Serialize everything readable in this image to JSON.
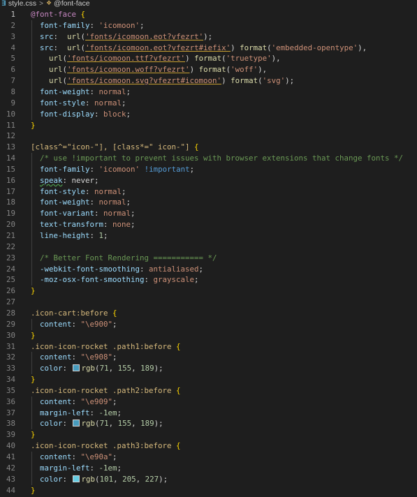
{
  "breadcrumb": {
    "file_icon": "css-file-icon",
    "file_name": "style.css",
    "separator": ">",
    "symbol_icon": "symbol-icon",
    "symbol_name": "@font-face"
  },
  "active_line": "1",
  "lines": [
    {
      "n": "1",
      "indent": 0,
      "tokens": [
        [
          "kw",
          "@font-face"
        ],
        [
          "punc",
          " "
        ],
        [
          "brace",
          "{"
        ]
      ]
    },
    {
      "n": "2",
      "indent": 1,
      "tokens": [
        [
          "prop",
          "font-family"
        ],
        [
          "punc",
          ": "
        ],
        [
          "str",
          "'icomoon'"
        ],
        [
          "punc",
          ";"
        ]
      ]
    },
    {
      "n": "3",
      "indent": 1,
      "tokens": [
        [
          "prop",
          "src"
        ],
        [
          "punc",
          ":  "
        ],
        [
          "fn",
          "url"
        ],
        [
          "punc",
          "("
        ],
        [
          "url ul",
          "'fonts/icomoon.eot?vfezrt'"
        ],
        [
          "punc",
          ");"
        ]
      ]
    },
    {
      "n": "4",
      "indent": 1,
      "tokens": [
        [
          "prop",
          "src"
        ],
        [
          "punc",
          ":  "
        ],
        [
          "fn",
          "url"
        ],
        [
          "punc",
          "("
        ],
        [
          "url ul",
          "'fonts/icomoon.eot?vfezrt#iefix'"
        ],
        [
          "punc",
          ") "
        ],
        [
          "fn",
          "format"
        ],
        [
          "punc",
          "("
        ],
        [
          "str",
          "'embedded-opentype'"
        ],
        [
          "punc",
          "),"
        ]
      ]
    },
    {
      "n": "5",
      "indent": 1,
      "tokens": [
        [
          "punc",
          "  "
        ],
        [
          "fn",
          "url"
        ],
        [
          "punc",
          "("
        ],
        [
          "url ul",
          "'fonts/icomoon.ttf?vfezrt'"
        ],
        [
          "punc",
          ") "
        ],
        [
          "fn",
          "format"
        ],
        [
          "punc",
          "("
        ],
        [
          "str",
          "'truetype'"
        ],
        [
          "punc",
          "),"
        ]
      ]
    },
    {
      "n": "6",
      "indent": 1,
      "tokens": [
        [
          "punc",
          "  "
        ],
        [
          "fn",
          "url"
        ],
        [
          "punc",
          "("
        ],
        [
          "url ul",
          "'fonts/icomoon.woff?vfezrt'"
        ],
        [
          "punc",
          ") "
        ],
        [
          "fn",
          "format"
        ],
        [
          "punc",
          "("
        ],
        [
          "str",
          "'woff'"
        ],
        [
          "punc",
          "),"
        ]
      ]
    },
    {
      "n": "7",
      "indent": 1,
      "tokens": [
        [
          "punc",
          "  "
        ],
        [
          "fn",
          "url"
        ],
        [
          "punc",
          "("
        ],
        [
          "url ul",
          "'fonts/icomoon.svg?vfezrt#icomoon'"
        ],
        [
          "punc",
          ") "
        ],
        [
          "fn",
          "format"
        ],
        [
          "punc",
          "("
        ],
        [
          "str",
          "'svg'"
        ],
        [
          "punc",
          ");"
        ]
      ]
    },
    {
      "n": "8",
      "indent": 1,
      "tokens": [
        [
          "prop",
          "font-weight"
        ],
        [
          "punc",
          ": "
        ],
        [
          "val",
          "normal"
        ],
        [
          "punc",
          ";"
        ]
      ]
    },
    {
      "n": "9",
      "indent": 1,
      "tokens": [
        [
          "prop",
          "font-style"
        ],
        [
          "punc",
          ": "
        ],
        [
          "val",
          "normal"
        ],
        [
          "punc",
          ";"
        ]
      ]
    },
    {
      "n": "10",
      "indent": 1,
      "tokens": [
        [
          "prop",
          "font-display"
        ],
        [
          "punc",
          ": "
        ],
        [
          "val",
          "block"
        ],
        [
          "punc",
          ";"
        ]
      ]
    },
    {
      "n": "11",
      "indent": 0,
      "tokens": [
        [
          "brace",
          "}"
        ]
      ]
    },
    {
      "n": "12",
      "indent": 0,
      "tokens": []
    },
    {
      "n": "13",
      "indent": 0,
      "tokens": [
        [
          "sel",
          "[class^=\"icon-\"], [class*=\" icon-\"]"
        ],
        [
          "punc",
          " "
        ],
        [
          "brace",
          "{"
        ]
      ]
    },
    {
      "n": "14",
      "indent": 1,
      "tokens": [
        [
          "com",
          "/* use !important to prevent issues with browser extensions that change fonts */"
        ]
      ]
    },
    {
      "n": "15",
      "indent": 1,
      "tokens": [
        [
          "prop",
          "font-family"
        ],
        [
          "punc",
          ": "
        ],
        [
          "str",
          "'icomoon'"
        ],
        [
          "punc",
          " "
        ],
        [
          "kwblue",
          "!important"
        ],
        [
          "punc",
          ";"
        ]
      ]
    },
    {
      "n": "16",
      "indent": 1,
      "tokens": [
        [
          "prop squig",
          "speak"
        ],
        [
          "punc",
          ": never;"
        ]
      ]
    },
    {
      "n": "17",
      "indent": 1,
      "tokens": [
        [
          "prop",
          "font-style"
        ],
        [
          "punc",
          ": "
        ],
        [
          "val",
          "normal"
        ],
        [
          "punc",
          ";"
        ]
      ]
    },
    {
      "n": "18",
      "indent": 1,
      "tokens": [
        [
          "prop",
          "font-weight"
        ],
        [
          "punc",
          ": "
        ],
        [
          "val",
          "normal"
        ],
        [
          "punc",
          ";"
        ]
      ]
    },
    {
      "n": "19",
      "indent": 1,
      "tokens": [
        [
          "prop",
          "font-variant"
        ],
        [
          "punc",
          ": "
        ],
        [
          "val",
          "normal"
        ],
        [
          "punc",
          ";"
        ]
      ]
    },
    {
      "n": "20",
      "indent": 1,
      "tokens": [
        [
          "prop",
          "text-transform"
        ],
        [
          "punc",
          ": "
        ],
        [
          "val",
          "none"
        ],
        [
          "punc",
          ";"
        ]
      ]
    },
    {
      "n": "21",
      "indent": 1,
      "tokens": [
        [
          "prop",
          "line-height"
        ],
        [
          "punc",
          ": "
        ],
        [
          "num",
          "1"
        ],
        [
          "punc",
          ";"
        ]
      ]
    },
    {
      "n": "22",
      "indent": 1,
      "tokens": []
    },
    {
      "n": "23",
      "indent": 1,
      "tokens": [
        [
          "com",
          "/* Better Font Rendering =========== */"
        ]
      ]
    },
    {
      "n": "24",
      "indent": 1,
      "tokens": [
        [
          "prop",
          "-webkit-font-smoothing"
        ],
        [
          "punc",
          ": "
        ],
        [
          "val",
          "antialiased"
        ],
        [
          "punc",
          ";"
        ]
      ]
    },
    {
      "n": "25",
      "indent": 1,
      "tokens": [
        [
          "prop",
          "-moz-osx-font-smoothing"
        ],
        [
          "punc",
          ": "
        ],
        [
          "val",
          "grayscale"
        ],
        [
          "punc",
          ";"
        ]
      ]
    },
    {
      "n": "26",
      "indent": 0,
      "tokens": [
        [
          "brace",
          "}"
        ]
      ]
    },
    {
      "n": "27",
      "indent": 0,
      "tokens": []
    },
    {
      "n": "28",
      "indent": 0,
      "tokens": [
        [
          "sel",
          ".icon-cart:before"
        ],
        [
          "punc",
          " "
        ],
        [
          "brace",
          "{"
        ]
      ]
    },
    {
      "n": "29",
      "indent": 1,
      "tokens": [
        [
          "prop",
          "content"
        ],
        [
          "punc",
          ": "
        ],
        [
          "str",
          "\"\\e900\""
        ],
        [
          "punc",
          ";"
        ]
      ]
    },
    {
      "n": "30",
      "indent": 0,
      "tokens": [
        [
          "brace",
          "}"
        ]
      ]
    },
    {
      "n": "31",
      "indent": 0,
      "tokens": [
        [
          "sel",
          ".icon-icon-rocket .path1:before"
        ],
        [
          "punc",
          " "
        ],
        [
          "brace",
          "{"
        ]
      ]
    },
    {
      "n": "32",
      "indent": 1,
      "tokens": [
        [
          "prop",
          "content"
        ],
        [
          "punc",
          ": "
        ],
        [
          "str",
          "\"\\e908\""
        ],
        [
          "punc",
          ";"
        ]
      ]
    },
    {
      "n": "33",
      "indent": 1,
      "tokens": [
        [
          "prop",
          "color"
        ],
        [
          "punc",
          ": "
        ],
        [
          "swatch",
          "#479bbd"
        ],
        [
          "fn",
          "rgb"
        ],
        [
          "punc",
          "("
        ],
        [
          "num",
          "71"
        ],
        [
          "punc",
          ", "
        ],
        [
          "num",
          "155"
        ],
        [
          "punc",
          ", "
        ],
        [
          "num",
          "189"
        ],
        [
          "punc",
          ");"
        ]
      ]
    },
    {
      "n": "34",
      "indent": 0,
      "tokens": [
        [
          "brace",
          "}"
        ]
      ]
    },
    {
      "n": "35",
      "indent": 0,
      "tokens": [
        [
          "sel",
          ".icon-icon-rocket .path2:before"
        ],
        [
          "punc",
          " "
        ],
        [
          "brace",
          "{"
        ]
      ]
    },
    {
      "n": "36",
      "indent": 1,
      "tokens": [
        [
          "prop",
          "content"
        ],
        [
          "punc",
          ": "
        ],
        [
          "str",
          "\"\\e909\""
        ],
        [
          "punc",
          ";"
        ]
      ]
    },
    {
      "n": "37",
      "indent": 1,
      "tokens": [
        [
          "prop",
          "margin-left"
        ],
        [
          "punc",
          ": "
        ],
        [
          "num",
          "-1em"
        ],
        [
          "punc",
          ";"
        ]
      ]
    },
    {
      "n": "38",
      "indent": 1,
      "tokens": [
        [
          "prop",
          "color"
        ],
        [
          "punc",
          ": "
        ],
        [
          "swatch",
          "#479bbd"
        ],
        [
          "fn",
          "rgb"
        ],
        [
          "punc",
          "("
        ],
        [
          "num",
          "71"
        ],
        [
          "punc",
          ", "
        ],
        [
          "num",
          "155"
        ],
        [
          "punc",
          ", "
        ],
        [
          "num",
          "189"
        ],
        [
          "punc",
          ");"
        ]
      ]
    },
    {
      "n": "39",
      "indent": 0,
      "tokens": [
        [
          "brace",
          "}"
        ]
      ]
    },
    {
      "n": "40",
      "indent": 0,
      "tokens": [
        [
          "sel",
          ".icon-icon-rocket .path3:before"
        ],
        [
          "punc",
          " "
        ],
        [
          "brace",
          "{"
        ]
      ]
    },
    {
      "n": "41",
      "indent": 1,
      "tokens": [
        [
          "prop",
          "content"
        ],
        [
          "punc",
          ": "
        ],
        [
          "str",
          "\"\\e90a\""
        ],
        [
          "punc",
          ";"
        ]
      ]
    },
    {
      "n": "42",
      "indent": 1,
      "tokens": [
        [
          "prop",
          "margin-left"
        ],
        [
          "punc",
          ": "
        ],
        [
          "num",
          "-1em"
        ],
        [
          "punc",
          ";"
        ]
      ]
    },
    {
      "n": "43",
      "indent": 1,
      "tokens": [
        [
          "prop",
          "color"
        ],
        [
          "punc",
          ": "
        ],
        [
          "swatch",
          "#65cde3"
        ],
        [
          "fn",
          "rgb"
        ],
        [
          "punc",
          "("
        ],
        [
          "num",
          "101"
        ],
        [
          "punc",
          ", "
        ],
        [
          "num",
          "205"
        ],
        [
          "punc",
          ", "
        ],
        [
          "num",
          "227"
        ],
        [
          "punc",
          ");"
        ]
      ]
    },
    {
      "n": "44",
      "indent": 0,
      "tokens": [
        [
          "brace",
          "}"
        ]
      ]
    }
  ]
}
